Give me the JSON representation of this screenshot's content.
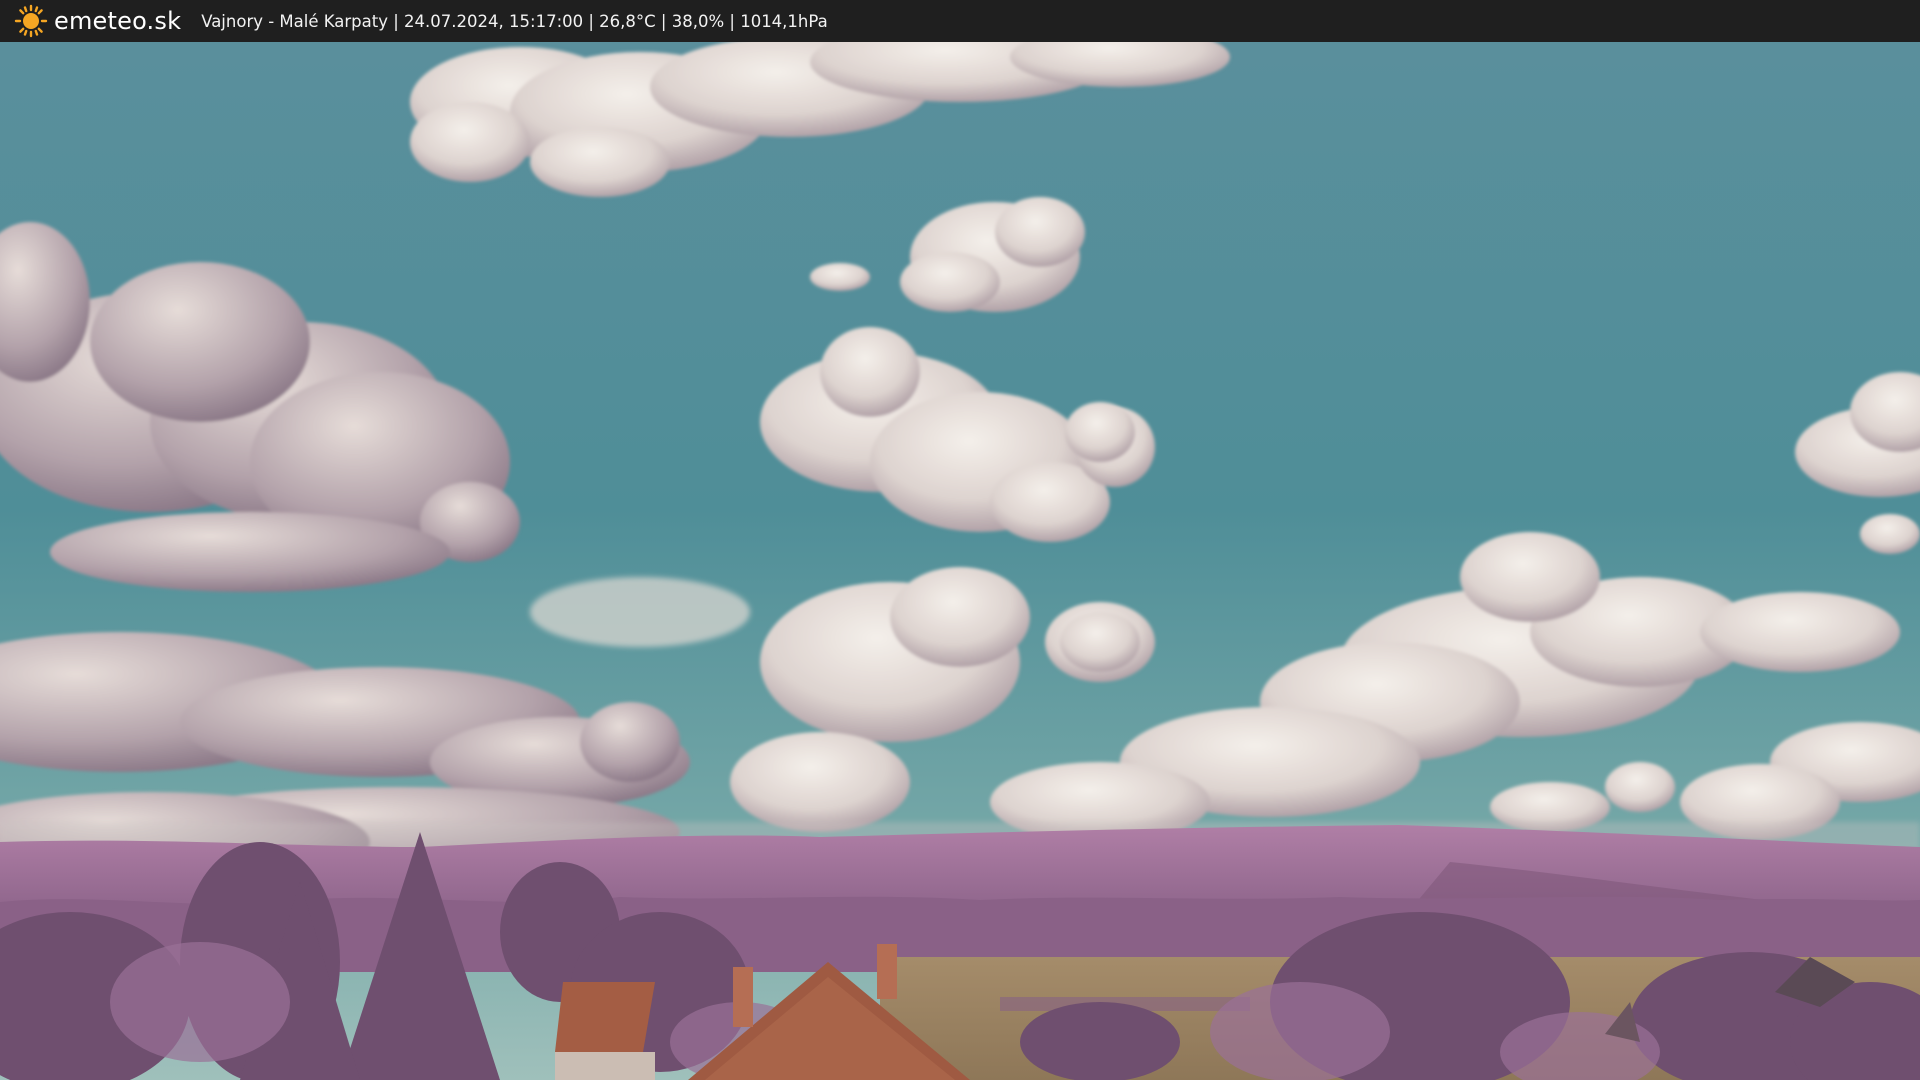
{
  "header": {
    "brand": "emeteo.sk",
    "caption": "Vajnory - Malé Karpaty | 24.07.2024, 15:17:00 | 26,8°C | 38,0% | 1014,1hPa",
    "logo_icon": "sun-icon"
  },
  "scene": {
    "description_icon": "webcam-landscape",
    "colors": {
      "sky_top": "#4f8c98",
      "sky_bottom": "#8ab3b3",
      "cloud": "#eae3de",
      "cloud_shadow": "#9c8a96",
      "hills": "#9a6f95",
      "trees": "#7a5878",
      "field": "#a48a62",
      "roof": "#a15b42"
    }
  }
}
